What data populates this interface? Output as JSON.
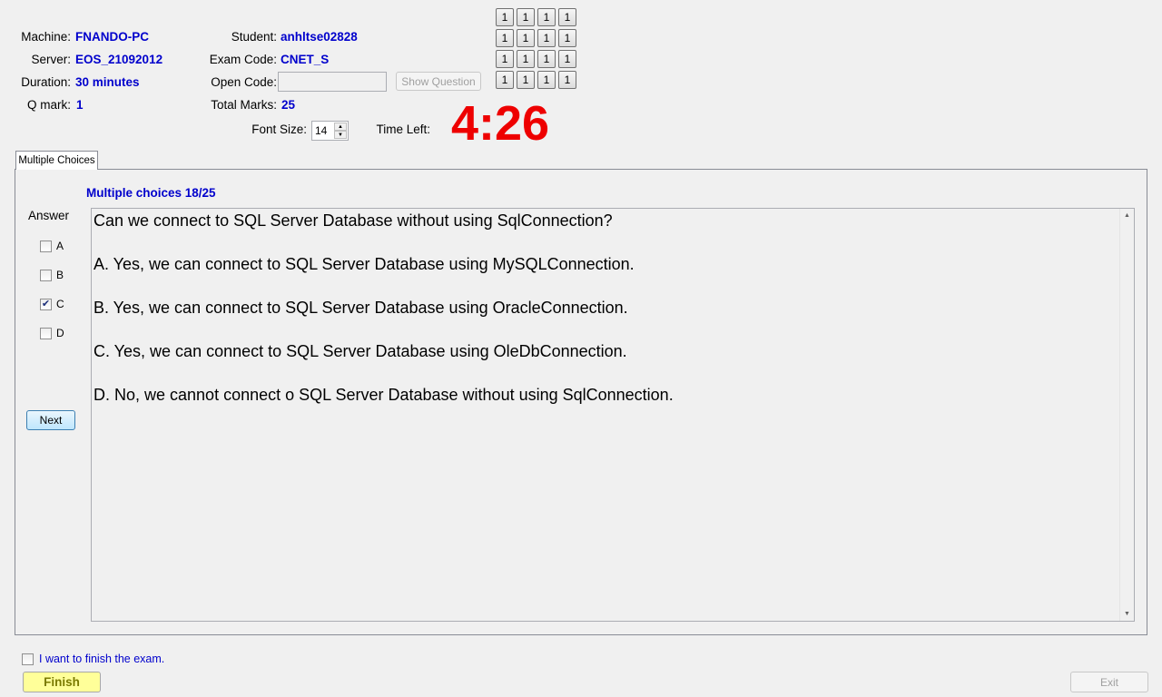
{
  "info": {
    "machine_label": "Machine:",
    "machine_value": "FNANDO-PC",
    "server_label": "Server:",
    "server_value": "EOS_21092012",
    "duration_label": "Duration:",
    "duration_value": "30 minutes",
    "qmark_label": "Q mark:",
    "qmark_value": "1",
    "student_label": "Student:",
    "student_value": "anhltse02828",
    "examcode_label": "Exam Code:",
    "examcode_value": "CNET_S",
    "opencode_label": "Open Code:",
    "opencode_value": "",
    "totalmarks_label": "Total Marks:",
    "totalmarks_value": "25",
    "show_question_label": "Show Question",
    "fontsize_label": "Font Size:",
    "fontsize_value": "14",
    "timeleft_label": "Time Left:",
    "timeleft_value": "4:26"
  },
  "question_grid": [
    [
      "1",
      "1",
      "1",
      "1"
    ],
    [
      "1",
      "1",
      "1",
      "1"
    ],
    [
      "1",
      "1",
      "1",
      "1"
    ],
    [
      "1",
      "1",
      "1",
      "1"
    ]
  ],
  "tab": {
    "label": "Multiple Choices"
  },
  "panel": {
    "heading": "Multiple choices 18/25",
    "answer_label": "Answer",
    "options": [
      {
        "label": "A",
        "checked": false
      },
      {
        "label": "B",
        "checked": false
      },
      {
        "label": "C",
        "checked": true
      },
      {
        "label": "D",
        "checked": false
      }
    ],
    "next_label": "Next",
    "question": "Can we connect to SQL Server Database without using SqlConnection?",
    "choices": [
      "A.  Yes, we can connect to SQL Server Database using MySQLConnection.",
      "B.  Yes, we can connect to SQL Server Database using OracleConnection.",
      "C.  Yes, we can connect to SQL Server Database using OleDbConnection.",
      "D.  No, we cannot connect o SQL Server Database without using SqlConnection."
    ]
  },
  "footer": {
    "finish_check_label": "I want to finish the exam.",
    "finish_label": "Finish",
    "exit_label": "Exit"
  },
  "colors": {
    "value_blue": "#0000cc",
    "timer_red": "#ee0000",
    "finish_yellow": "#ffff99",
    "finish_text": "#7a7a00"
  },
  "icons": [
    "checkmark-icon",
    "spin-up-icon",
    "spin-down-icon",
    "scroll-up-icon",
    "scroll-down-icon"
  ]
}
